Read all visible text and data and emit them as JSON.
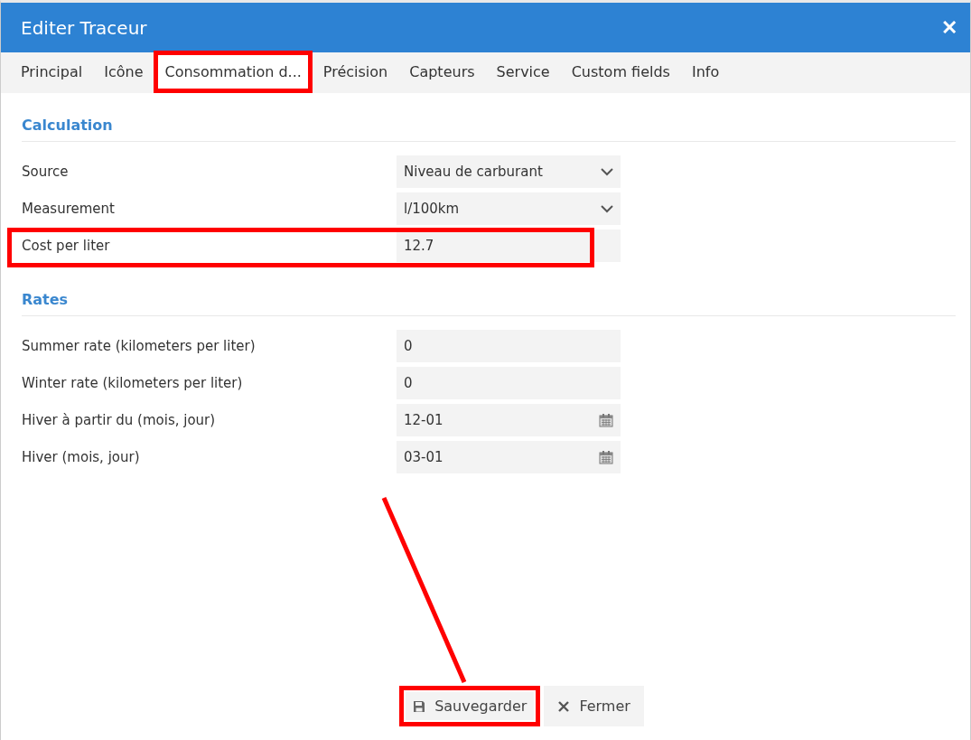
{
  "window": {
    "title": "Editer Traceur",
    "close": "✕"
  },
  "tabs": [
    {
      "label": "Principal",
      "selected": false,
      "highlighted": false
    },
    {
      "label": "Icône",
      "selected": false,
      "highlighted": false
    },
    {
      "label": "Consommation d...",
      "selected": true,
      "highlighted": true
    },
    {
      "label": "Précision",
      "selected": false,
      "highlighted": false
    },
    {
      "label": "Capteurs",
      "selected": false,
      "highlighted": false
    },
    {
      "label": "Service",
      "selected": false,
      "highlighted": false
    },
    {
      "label": "Custom fields",
      "selected": false,
      "highlighted": false
    },
    {
      "label": "Info",
      "selected": false,
      "highlighted": false
    }
  ],
  "sections": [
    {
      "title": "Calculation",
      "rows": [
        {
          "label": "Source",
          "kind": "select",
          "value": "Niveau de carburant",
          "highlighted": false
        },
        {
          "label": "Measurement",
          "kind": "select",
          "value": "l/100km",
          "highlighted": false
        },
        {
          "label": "Cost per liter",
          "kind": "text",
          "value": "12.7",
          "highlighted": true
        }
      ]
    },
    {
      "title": "Rates",
      "rows": [
        {
          "label": "Summer rate (kilometers per liter)",
          "kind": "text",
          "value": "0",
          "highlighted": false
        },
        {
          "label": "Winter rate (kilometers per liter)",
          "kind": "text",
          "value": "0",
          "highlighted": false
        },
        {
          "label": "Hiver à partir du (mois, jour)",
          "kind": "date",
          "value": "12-01",
          "highlighted": false
        },
        {
          "label": "Hiver (mois, jour)",
          "kind": "date",
          "value": "03-01",
          "highlighted": false
        }
      ]
    }
  ],
  "buttons": [
    {
      "label": "Sauvegarder",
      "kind": "save",
      "highlighted": true,
      "arrow": true
    },
    {
      "label": "Fermer",
      "kind": "close",
      "highlighted": false,
      "arrow": false
    }
  ]
}
